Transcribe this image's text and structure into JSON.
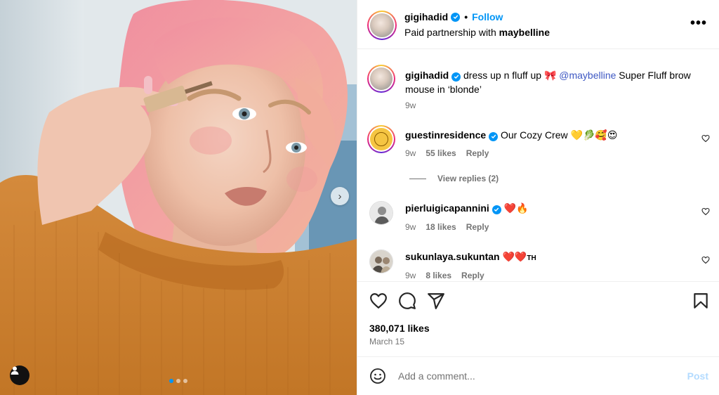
{
  "header": {
    "username": "gigihadid",
    "follow_label": "Follow",
    "separator": "•",
    "subtitle_prefix": "Paid partnership with ",
    "partner": "maybelline",
    "more_icon": "more-options-icon"
  },
  "caption": {
    "username": "gigihadid",
    "text_before": " dress up n fluff up ",
    "bow_emoji": "🎀",
    "mention": "@maybelline",
    "text_after": " Super Fluff brow mouse in ‘blonde’",
    "time": "9w"
  },
  "comments": [
    {
      "username": "guestinresidence",
      "text": "Our Cozy Crew ",
      "emojis": [
        "💛",
        "🥬",
        "🥰",
        "😍"
      ],
      "time": "9w",
      "likes": "55 likes",
      "reply": "Reply"
    },
    {
      "username": "pierluigicapannini",
      "text": "",
      "emojis": [
        "❤️",
        "🔥"
      ],
      "time": "9w",
      "likes": "18 likes",
      "reply": "Reply"
    },
    {
      "username": "sukunlaya.sukuntan",
      "text": "",
      "emojis": [
        "❤️",
        "❤️"
      ],
      "suffix": "TH",
      "time": "9w",
      "likes": "8 likes",
      "reply": "Reply"
    }
  ],
  "view_replies": "View replies (2)",
  "post": {
    "likes": "380,071 likes",
    "date": "March 15"
  },
  "add_comment": {
    "placeholder": "Add a comment...",
    "post_label": "Post"
  },
  "colors": {
    "accent": "#0095f6",
    "mention": "#3e58c3",
    "muted": "#737373",
    "post_disabled": "#b3dbff"
  }
}
